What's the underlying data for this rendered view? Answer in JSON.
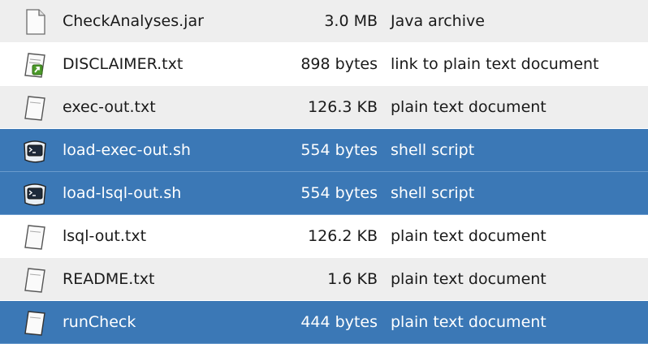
{
  "colors": {
    "row_alt": "#eeeeee",
    "row_plain": "#ffffff",
    "selection": "#3b78b6",
    "selection_text": "#ffffff"
  },
  "files": [
    {
      "name": "CheckAnalyses.jar",
      "size": "3.0 MB",
      "type": "Java archive",
      "icon": "java-archive-icon",
      "selected": false
    },
    {
      "name": "DISCLAIMER.txt",
      "size": "898 bytes",
      "type": "link to plain text document",
      "icon": "text-link-icon",
      "selected": false
    },
    {
      "name": "exec-out.txt",
      "size": "126.3 KB",
      "type": "plain text document",
      "icon": "text-document-icon",
      "selected": false
    },
    {
      "name": "load-exec-out.sh",
      "size": "554 bytes",
      "type": "shell script",
      "icon": "shell-script-icon",
      "selected": true
    },
    {
      "name": "load-lsql-out.sh",
      "size": "554 bytes",
      "type": "shell script",
      "icon": "shell-script-icon",
      "selected": true
    },
    {
      "name": "lsql-out.txt",
      "size": "126.2 KB",
      "type": "plain text document",
      "icon": "text-document-icon",
      "selected": false
    },
    {
      "name": "README.txt",
      "size": "1.6 KB",
      "type": "plain text document",
      "icon": "text-document-icon",
      "selected": false
    },
    {
      "name": "runCheck",
      "size": "444 bytes",
      "type": "plain text document",
      "icon": "text-document-icon",
      "selected": true
    }
  ]
}
